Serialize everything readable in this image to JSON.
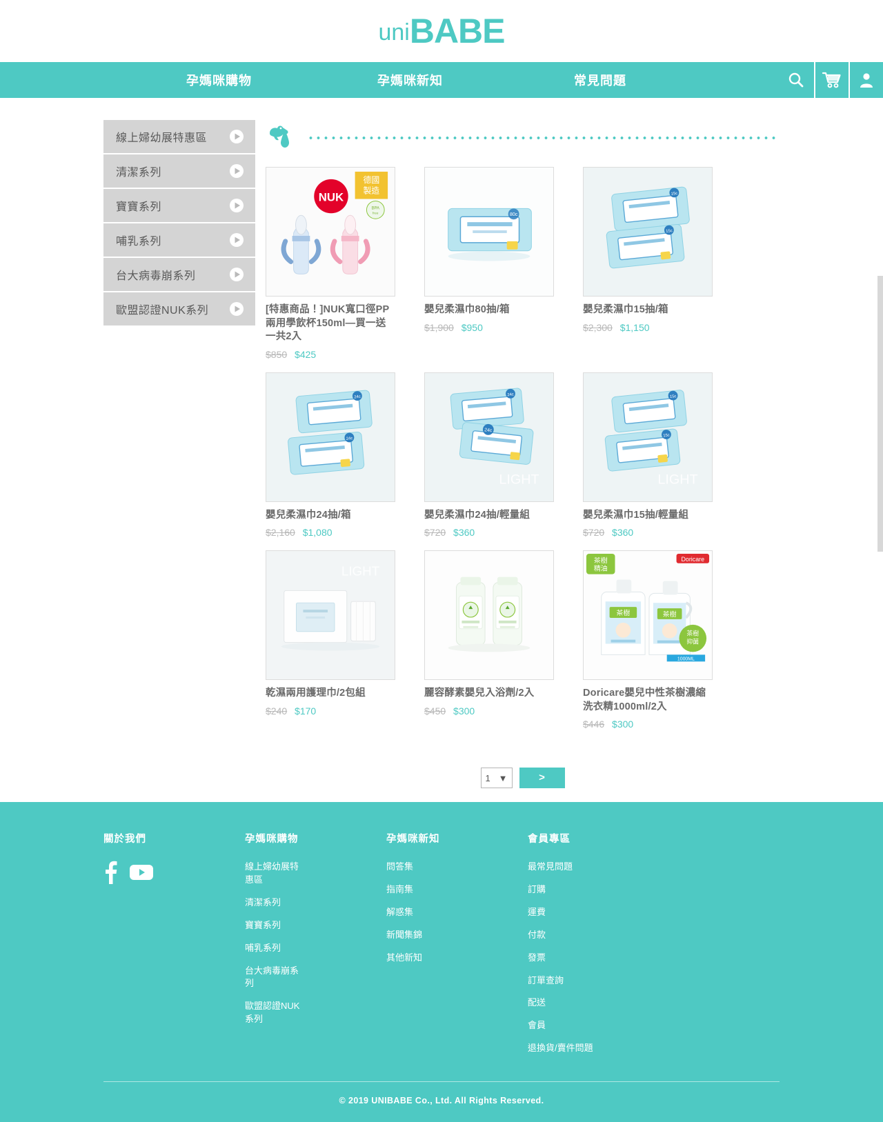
{
  "brand": {
    "prefix": "uni",
    "name": "BABE"
  },
  "nav": {
    "links": [
      {
        "label": "孕媽咪購物"
      },
      {
        "label": "孕媽咪新知"
      },
      {
        "label": "常見問題"
      }
    ],
    "icons": [
      {
        "name": "search-icon",
        "label": "搜尋"
      },
      {
        "name": "cart-icon",
        "label": "購物車"
      },
      {
        "name": "user-icon",
        "label": "會員"
      }
    ]
  },
  "sidebar": {
    "items": [
      {
        "label": "線上婦幼展特惠區"
      },
      {
        "label": "清潔系列"
      },
      {
        "label": "寶寶系列"
      },
      {
        "label": "哺乳系列"
      },
      {
        "label": "台大病毒崩系列"
      },
      {
        "label": "歐盟認證NUK系列"
      }
    ]
  },
  "products": [
    {
      "title": "[特惠商品！]NUK寬口徑PP兩用學飲杯150ml—買一送一共2入",
      "old_price": "$850",
      "new_price": "$425",
      "image": "nuk-learner-cups",
      "badges": [
        "NUK",
        "德國製造",
        "BPA free"
      ]
    },
    {
      "title": "嬰兒柔濕巾80抽/箱",
      "old_price": "$1,900",
      "new_price": "$950",
      "image": "wipes-80-single"
    },
    {
      "title": "嬰兒柔濕巾15抽/箱",
      "old_price": "$2,300",
      "new_price": "$1,150",
      "image": "wipes-15-pair"
    },
    {
      "title": "嬰兒柔濕巾24抽/箱",
      "old_price": "$2,160",
      "new_price": "$1,080",
      "image": "wipes-24-pair"
    },
    {
      "title": "嬰兒柔濕巾24抽/輕量組",
      "old_price": "$720",
      "new_price": "$360",
      "image": "wipes-24-light"
    },
    {
      "title": "嬰兒柔濕巾15抽/輕量組",
      "old_price": "$720",
      "new_price": "$360",
      "image": "wipes-15-light"
    },
    {
      "title": "乾濕兩用護理巾/2包組",
      "old_price": "$240",
      "new_price": "$170",
      "image": "dry-wet-towels"
    },
    {
      "title": "麗容酵素嬰兒入浴劑/2入",
      "old_price": "$450",
      "new_price": "$300",
      "image": "bath-enzyme-bottles"
    },
    {
      "title": "Doricare嬰兒中性茶樹濃縮洗衣精1000ml/2入",
      "old_price": "$446",
      "new_price": "$300",
      "image": "doricare-detergent"
    }
  ],
  "pagination": {
    "current_page": "1",
    "next_label": ">"
  },
  "footer": {
    "about": {
      "title": "關於我們",
      "social": [
        {
          "name": "facebook-icon"
        },
        {
          "name": "youtube-icon"
        }
      ]
    },
    "shop": {
      "title": "孕媽咪購物",
      "links": [
        "線上婦幼展特惠區",
        "清潔系列",
        "寶寶系列",
        "哺乳系列",
        "台大病毒崩系列",
        "歐盟認證NUK系列"
      ]
    },
    "news": {
      "title": "孕媽咪新知",
      "links": [
        "問答集",
        "指南集",
        "解惑集",
        "新聞集錦",
        "其他新知"
      ]
    },
    "member": {
      "title": "會員專區",
      "links": [
        "最常見問題",
        "訂購",
        "運費",
        "付款",
        "發票",
        "訂單查詢",
        "配送",
        "會員",
        "退換貨/賣件問題"
      ]
    },
    "copyright": "© 2019 UNIBABE Co., Ltd. All Rights Reserved."
  },
  "colors": {
    "brand": "#4ec9c3",
    "sidebar_item": "#d4d4d4",
    "price_new": "#4ec9c3",
    "price_old": "#b7b7b7"
  }
}
